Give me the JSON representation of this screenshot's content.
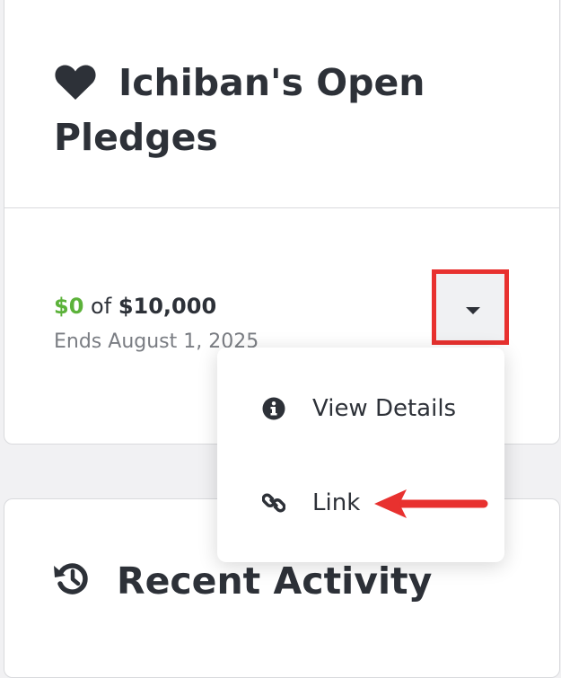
{
  "pledges_card": {
    "title": "Ichiban's Open Pledges",
    "title_icon": "heart-icon"
  },
  "pledge": {
    "raised": "$0",
    "of_word": "of",
    "goal": "$10,000",
    "ends": "Ends August 1, 2025"
  },
  "dropdown": {
    "toggle_icon": "caret-down-icon",
    "items": [
      {
        "label": "View Details",
        "icon": "info-circle-icon"
      },
      {
        "label": "Link",
        "icon": "link-icon"
      }
    ]
  },
  "activity_card": {
    "title": "Recent Activity",
    "title_icon": "history-icon"
  },
  "colors": {
    "raised_amount": "#5cb23a",
    "highlight": "#e8312f",
    "text": "#2d3138",
    "muted": "#7a7d83"
  }
}
